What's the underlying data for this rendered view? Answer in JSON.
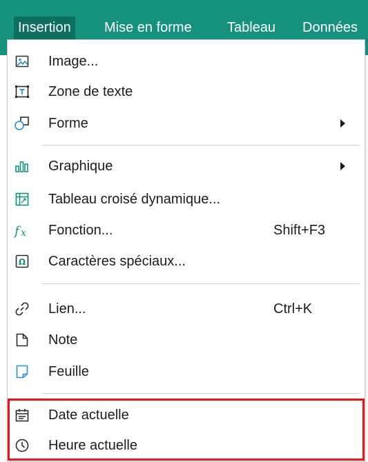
{
  "menubar": {
    "items": [
      {
        "label": "Insertion",
        "active": true
      },
      {
        "label": "Mise en forme"
      },
      {
        "label": "Tableau"
      },
      {
        "label": "Données"
      }
    ],
    "color": "#15917e"
  },
  "menu": {
    "groups": [
      [
        {
          "label": "Image...",
          "icon": "image-icon"
        },
        {
          "label": "Zone de texte",
          "icon": "text-box-icon"
        },
        {
          "label": "Forme",
          "icon": "shape-icon",
          "submenu": true
        }
      ],
      [
        {
          "label": "Graphique",
          "icon": "chart-icon",
          "submenu": true
        },
        {
          "label": "Tableau croisé dynamique...",
          "icon": "pivot-table-icon"
        },
        {
          "label": "Fonction...",
          "icon": "function-icon",
          "shortcut": "Shift+F3"
        },
        {
          "label": "Caractères spéciaux...",
          "icon": "omega-icon"
        }
      ],
      [
        {
          "label": "Lien...",
          "icon": "link-icon",
          "shortcut": "Ctrl+K"
        },
        {
          "label": "Note",
          "icon": "note-icon"
        },
        {
          "label": "Feuille",
          "icon": "sheet-icon"
        }
      ],
      [
        {
          "label": "Date actuelle",
          "icon": "calendar-icon"
        },
        {
          "label": "Heure actuelle",
          "icon": "clock-icon"
        }
      ]
    ]
  },
  "highlight_color": "#e8141a"
}
